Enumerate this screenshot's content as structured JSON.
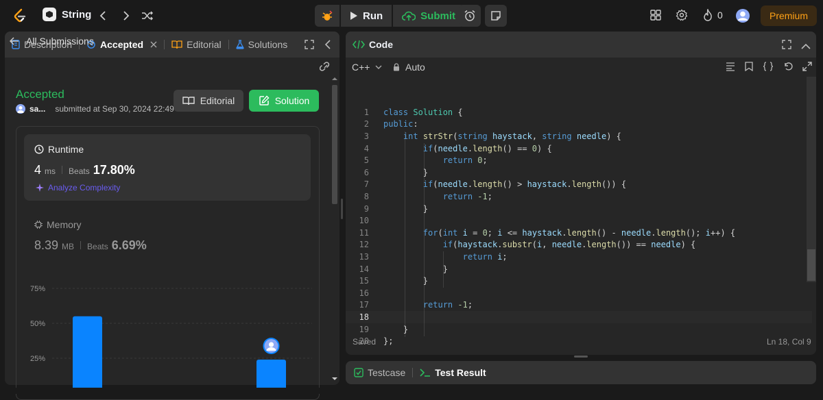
{
  "topbar": {
    "problem_list_label": "String",
    "run_label": "Run",
    "submit_label": "Submit",
    "streak_count": "0",
    "premium_label": "Premium"
  },
  "left_panel": {
    "tabs": [
      {
        "label": "Description",
        "icon": "document-icon",
        "active": false
      },
      {
        "label": "Accepted",
        "icon": "history-icon",
        "active": true
      },
      {
        "label": "Editorial",
        "icon": "book-icon",
        "active": false
      },
      {
        "label": "Solutions",
        "icon": "flask-icon",
        "active": false
      }
    ],
    "back_label": "All Submissions",
    "status": "Accepted",
    "username": "sa...",
    "submitted_at": "submitted at Sep 30, 2024 22:49",
    "editorial_button": "Editorial",
    "solution_button": "Solution",
    "runtime": {
      "title": "Runtime",
      "value": "4",
      "unit": "ms",
      "beats_label": "Beats",
      "beats_value": "17.80%",
      "analyze_label": "Analyze Complexity"
    },
    "memory": {
      "title": "Memory",
      "value": "8.39",
      "unit": "MB",
      "beats_label": "Beats",
      "beats_value": "6.69%"
    }
  },
  "chart_data": {
    "type": "bar",
    "y_ticks": [
      "75%",
      "50%",
      "25%"
    ],
    "ylim": [
      0,
      75
    ],
    "bars": [
      {
        "value": 55,
        "user": false
      },
      {
        "value": 24,
        "user": true
      }
    ]
  },
  "code_panel": {
    "title": "Code",
    "language": "C++",
    "mode": "Auto",
    "status": "Saved",
    "cursor": "Ln 18, Col 9",
    "current_line": 18,
    "lines": [
      "class Solution {",
      "public:",
      "    int strStr(string haystack, string needle) {",
      "        if(needle.length() == 0) {",
      "            return 0;",
      "        }",
      "        if(needle.length() > haystack.length()) {",
      "            return -1;",
      "        }",
      "",
      "        for(int i = 0; i <= haystack.length() - needle.length(); i++) {",
      "            if(haystack.substr(i, needle.length()) == needle) {",
      "                return i;",
      "            }",
      "        }",
      "",
      "        return -1;",
      "",
      "    }",
      "};"
    ]
  },
  "bottom_panel": {
    "testcase_label": "Testcase",
    "test_result_label": "Test Result"
  },
  "colors": {
    "accent_green": "#2cbb5d",
    "premium": "#ffa116",
    "bar_blue": "#0a84ff"
  }
}
